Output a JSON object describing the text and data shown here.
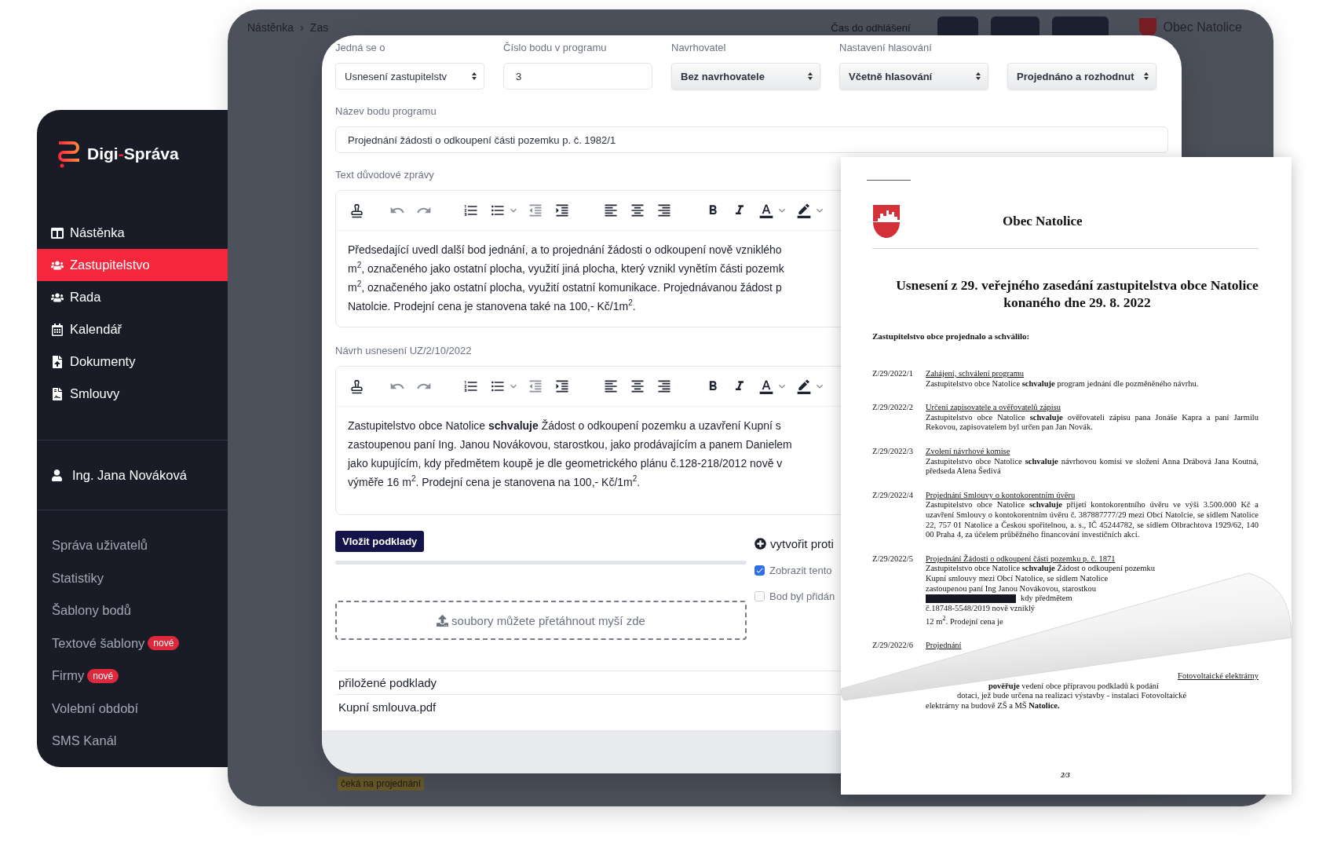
{
  "back_window": {
    "breadcrumb": [
      "Nástěnka",
      "Zas"
    ],
    "breadcrumb_separator": "›",
    "session": "Čas do odhlášení",
    "municipality": "Obec Natolice",
    "status_badge": "čeká na projednání"
  },
  "sidebar": {
    "logo": {
      "prefix": "Digi",
      "separator": "-",
      "suffix": "Správa"
    },
    "nav": [
      {
        "label": "Nástěnka",
        "selected": false
      },
      {
        "label": "Zastupitelstvo",
        "selected": true
      },
      {
        "label": "Rada",
        "selected": false
      },
      {
        "label": "Kalendář",
        "selected": false
      },
      {
        "label": "Dokumenty",
        "selected": false
      },
      {
        "label": "Smlouvy",
        "selected": false
      }
    ],
    "user": "Ing. Jana Nováková",
    "admin": [
      {
        "label": "Správa uživatelů"
      },
      {
        "label": "Statistiky"
      },
      {
        "label": "Šablony bodů"
      },
      {
        "label": "Textové šablony",
        "badge": "nové"
      },
      {
        "label": "Firmy",
        "badge": "nové"
      },
      {
        "label": "Volební období"
      },
      {
        "label": "SMS Kanál"
      }
    ]
  },
  "form": {
    "fields": [
      {
        "label": "Jedná se o",
        "value": "Usnesení zastupitelstv",
        "kind": "select"
      },
      {
        "label": "Číslo bodu v programu",
        "value": "3",
        "kind": "input"
      },
      {
        "label": "Navrhovatel",
        "value": "Bez navrhovatele",
        "kind": "select_shaded"
      },
      {
        "label": "Nastavení hlasování",
        "value": "Včetně hlasování",
        "kind": "select_shaded"
      },
      {
        "value": "Projednáno a rozhodnut",
        "kind": "select_shaded"
      }
    ],
    "title_label": "Název bodu programu",
    "title_value": "Projednání žádosti o odkoupení části pozemku p. č. 1982/1",
    "editors": [
      {
        "label": "Text důvodové zprávy",
        "lines": [
          "Předsedající uvedl další bod jednání, a to projednání žádosti o odkoupení nově vzniklého",
          "m$^{2}$, označeného jako ostatní plocha, využití jiná plocha, který vznikl vynětím části pozemk",
          "m$^{2}$, označeného jako ostatní plocha, využití ostatní komunikace. Projednávanou žádost p",
          "Natolcie.  Prodejní cena je stanovena také na 100,- Kč/1m$^{2}$."
        ]
      },
      {
        "label": "Návrh usnesení UZ/2/10/2022",
        "lines": [
          "Zastupitelstvo obce Natolice **schvaluje** Žádost o odkoupení pozemku a uzavření Kupní s",
          "zastoupenou paní Ing. Janou Novákovou, starostkou, jako prodávajícím a panem Danielem",
          "jako kupujícím, kdy předmětem koupě je dle geometrického plánu č.128-218/2012 nově v",
          "výměře 16 m$^{2}$. Prodejní cena je stanovena na 100,- Kč/1m$^{2}$."
        ]
      }
    ],
    "upload_button": "Vložit podklady",
    "dropzone": "soubory můžete přetáhnout myší zde",
    "create_link": "vytvořit proti",
    "checkboxes": [
      {
        "label": "Zobrazit tento",
        "checked": true
      },
      {
        "label": "Bod byl přidán",
        "checked": false
      }
    ],
    "attachments": {
      "header": "přiložené podklady",
      "rows": [
        "Kupní smlouva.pdf"
      ]
    }
  },
  "document": {
    "heading": "Obec Natolice",
    "title": "Usnesení z 29. veřejného zasedání zastupitelstva obce Natolice konaného dne 29. 8. 2022",
    "intro": "Zastupitelstvo obce projednalo a schválilo:",
    "items": [
      {
        "kind": "full",
        "number": "Z/29/2022/1",
        "title": "Zahájení, schválení programu",
        "body": "Zastupitelstvo obce Natolice **schvaluje** program jednání dle pozměněného návrhu."
      },
      {
        "kind": "full",
        "number": "Z/29/2022/2",
        "title": "Určení zapisovatele a ověřovatelů zápisu",
        "body": "Zastupitelstvo obce Natolice **schvaluje** ověřovateli zápisu pana Jonáše Kapra a paní Jarmilu Rekovou, zapisovatelem byl určen pan Jan Novák."
      },
      {
        "kind": "full",
        "number": "Z/29/2022/3",
        "title": "Zvolení návrhové komise",
        "body": "Zastupitelstvo obce Natolice **schvaluje** návrhovou komisi ve složení Anna Drábová Jana Koutná, předseda Alena Šedivá"
      },
      {
        "kind": "full",
        "number": "Z/29/2022/4",
        "title": "Projednání Smlouvy o kontokorentním úvěru",
        "body": "Zastupitelstvo obce Natolice **schvaluje** přijetí kontokorentního úvěru ve výši 3.500.000 Kč a uzavření Smlouvy o kontokorentním úvěru č. 387887777/29 mezi Obcí Natolcie, se sídlem Natolice 22, 757 01 Natolice a Českou spořitelnou, a. s., IČ 45244782, se sídlem Olbrachtova 1929/62, 140 00 Praha 4, za účelem průběžného financování investičních akcí."
      },
      {
        "kind": "partial",
        "number": "Z/29/2022/5",
        "title": "Projednání Žádosti o odkoupení části pozemku p. č. 1871",
        "lines": [
          {
            "text": "Zastupitelstvo obce Natolice **schvaluje** Žádost o odkoupení pozemku",
            "redacted": false
          },
          {
            "text": "Kupní smlouvy mezi Obcí Natolice, se sídlem Natolice",
            "redacted": false
          },
          {
            "text": "zastoupenou paní Ing Janou Novákovou, starostkou",
            "redacted": false
          },
          {
            "text": "kdy předmětem",
            "redacted": true
          },
          {
            "text": "č.18748-5548/2019 nově vzniklý",
            "redacted": false
          },
          {
            "text": "12 m$^{2}$. Prodejní cena je",
            "redacted": false
          }
        ]
      },
      {
        "kind": "covered",
        "number": "Z/29/2022/6",
        "title": "Projednání",
        "tail_title": "Fotovoltaické elektrárny",
        "tail_lines": [
          "**pověřuje** vedení obce přípravou podkladů k podání",
          "dotaci, jež bude určena na realizaci výstavby - instalaci Fotovoltaické",
          "elektrárny na budově ZŠ a MŠ **Natolice.**"
        ]
      }
    ],
    "page": "2/3"
  }
}
